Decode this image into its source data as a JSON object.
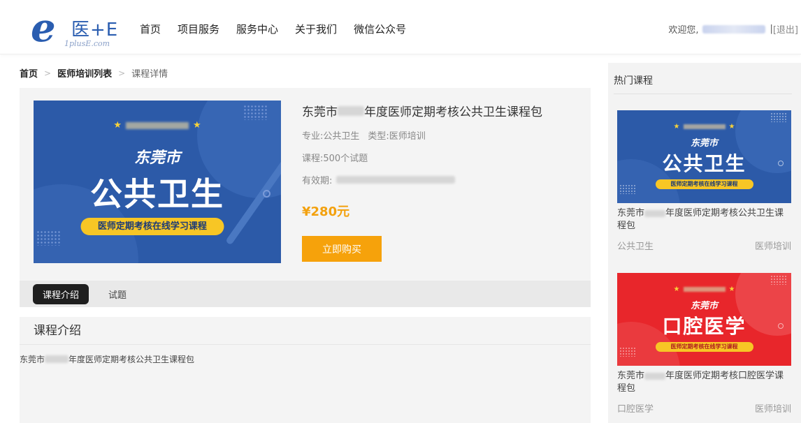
{
  "logo": {
    "mark": "e",
    "text": "医+E",
    "sub": "1plusE.com"
  },
  "nav": [
    "首页",
    "项目服务",
    "服务中心",
    "关于我们",
    "微信公众号"
  ],
  "user": {
    "welcome": "欢迎您,",
    "divider": "|",
    "logout": "[退出]"
  },
  "breadcrumb": {
    "home": "首页",
    "list": "医师培训列表",
    "current": "课程详情",
    "sep": ">"
  },
  "course": {
    "title_pre": "东莞市",
    "title_post": "年度医师定期考核公共卫生课程包",
    "specialty": "专业:公共卫生",
    "type": "类型:医师培训",
    "lessons": "课程:500个试题",
    "validity_label": "有效期:",
    "price": "¥280元",
    "buy_label": "立即购买",
    "cover": {
      "star": "★",
      "city": "东莞市",
      "headline": "公共卫生",
      "banner": "医师定期考核在线学习课程",
      "color": "#2c5aa8"
    }
  },
  "tabs": [
    {
      "label": "课程介绍",
      "active": true
    },
    {
      "label": "试题",
      "active": false
    }
  ],
  "intro": {
    "heading": "课程介绍",
    "text_pre": "东莞市",
    "text_post": "年度医师定期考核公共卫生课程包"
  },
  "sidebar": {
    "heading": "热门课程",
    "cards": [
      {
        "city": "东莞市",
        "headline": "公共卫生",
        "banner": "医师定期考核在线学习课程",
        "title_pre": "东莞市",
        "title_post": "年度医师定期考核公共卫生课程包",
        "specialty": "公共卫生",
        "type": "医师培训",
        "color": "#2c5aa8"
      },
      {
        "city": "东莞市",
        "headline": "口腔医学",
        "banner": "医师定期考核在线学习课程",
        "title_pre": "东莞市",
        "title_post": "年度医师定期考核口腔医学课程包",
        "specialty": "口腔医学",
        "type": "医师培训",
        "color": "#e8262b"
      }
    ]
  }
}
